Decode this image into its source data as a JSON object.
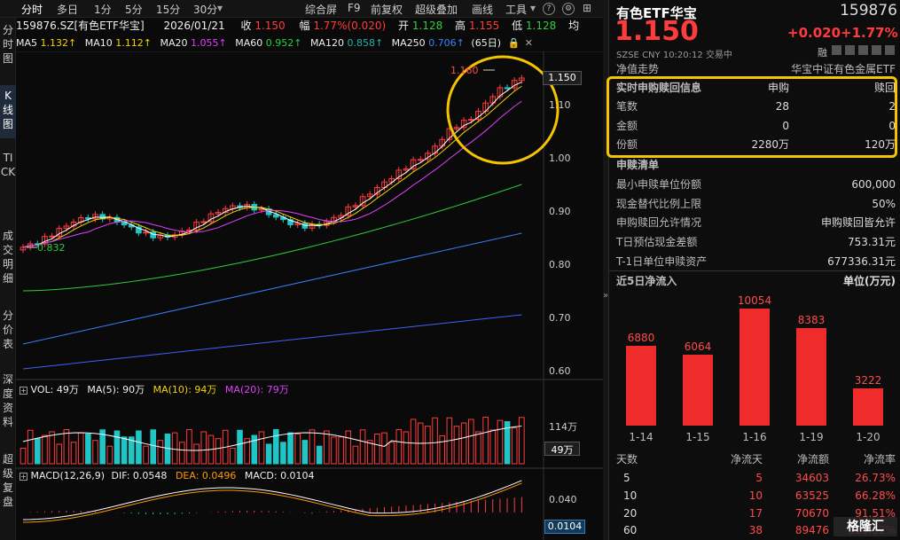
{
  "left_tabs": [
    "分时图",
    "K线图",
    "TICK",
    "成交明细",
    "分价表",
    "深度资料",
    "超级复盘"
  ],
  "top_tabs": [
    "分时",
    "多日",
    "1分",
    "5分",
    "15分",
    "30分"
  ],
  "top_tools": [
    "综合屏",
    "F9",
    "前复权",
    "超级叠加",
    "画线",
    "工具"
  ],
  "info": {
    "code": "159876.SZ[有色ETF华宝]",
    "date": "2026/01/21",
    "close_lbl": "收",
    "close": "1.150",
    "amp_lbl": "幅",
    "amp": "1.77%(0.020)",
    "open_lbl": "开",
    "open": "1.128",
    "high_lbl": "高",
    "high": "1.155",
    "low_lbl": "低",
    "low": "1.128",
    "avg_lbl": "均"
  },
  "ma": {
    "ma5": "MA5",
    "ma5v": "1.132↑",
    "ma10": "MA10",
    "ma10v": "1.112↑",
    "ma20": "MA20",
    "ma20v": "1.055↑",
    "ma60": "MA60",
    "ma60v": "0.952↑",
    "ma120": "MA120",
    "ma120v": "0.858↑",
    "ma250": "MA250",
    "ma250v": "0.706↑",
    "period": "(65日)"
  },
  "kline": {
    "price_label": "1.150",
    "high_mark": "1.160",
    "low_mark": "0.832",
    "ticks": [
      "1.10",
      "1.00",
      "0.90",
      "0.80",
      "0.70",
      "0.60"
    ]
  },
  "vol": {
    "title": "VOL: 49万",
    "ma5": "MA(5): 90万",
    "ma10": "MA(10): 94万",
    "ma20": "MA(20): 79万",
    "tick_top": "114万",
    "label": "49万"
  },
  "macd": {
    "title": "MACD(12,26,9)",
    "dif": "DIF: 0.0548",
    "dea": "DEA: 0.0496",
    "macd": "MACD: 0.0104",
    "tick": "0.040",
    "label": "0.0104"
  },
  "right": {
    "name": "有色ETF华宝",
    "code": "159876",
    "price": "1.150",
    "change": "+0.020",
    "pct": "+1.77%",
    "exchange": "SZSE",
    "currency": "CNY",
    "time": "10:20:12",
    "status": "交易中",
    "rong": "融",
    "nav_lbl": "净值走势",
    "nav_index": "华宝中证有色金属ETF",
    "sub_title": "实时申购赎回信息",
    "sub_col1": "申购",
    "sub_col2": "赎回",
    "sub_rows": [
      {
        "l": "笔数",
        "a": "28",
        "b": "2"
      },
      {
        "l": "金额",
        "a": "0",
        "b": "0"
      },
      {
        "l": "份额",
        "a": "2280万",
        "b": "120万"
      }
    ],
    "list_title": "申赎清单",
    "list_rows": [
      {
        "l": "最小申赎单位份额",
        "r": "600,000"
      },
      {
        "l": "现金替代比例上限",
        "r": "50%"
      },
      {
        "l": "申购赎回允许情况",
        "r": "申购赎回皆允许"
      },
      {
        "l": "T日预估现金差额",
        "r": "753.31元"
      },
      {
        "l": "T-1日单位申赎资产",
        "r": "677336.31元"
      }
    ],
    "flow_title": "近5日净流入",
    "flow_unit": "单位(万元)",
    "flow_head": [
      "天数",
      "净流天",
      "净流额",
      "净流率"
    ],
    "flow_rows": [
      {
        "d": "5",
        "n": "5",
        "v": "34603",
        "p": "26.73%"
      },
      {
        "d": "10",
        "n": "10",
        "v": "63525",
        "p": "66.28%"
      },
      {
        "d": "20",
        "n": "17",
        "v": "70670",
        "p": "91.51%"
      },
      {
        "d": "60",
        "n": "38",
        "v": "89476",
        "p": "123.52%"
      }
    ],
    "watermark": "格隆汇"
  },
  "chart_data": {
    "type": "bar",
    "title": "近5日净流入",
    "ylabel": "单位(万元)",
    "categories": [
      "1-14",
      "1-15",
      "1-16",
      "1-19",
      "1-20"
    ],
    "values": [
      6880,
      6064,
      10054,
      8383,
      3222
    ]
  },
  "colors": {
    "up": "#ff3b3b",
    "down": "#2ecc40",
    "highlight": "#f5c400",
    "bg": "#0a0a0a"
  }
}
